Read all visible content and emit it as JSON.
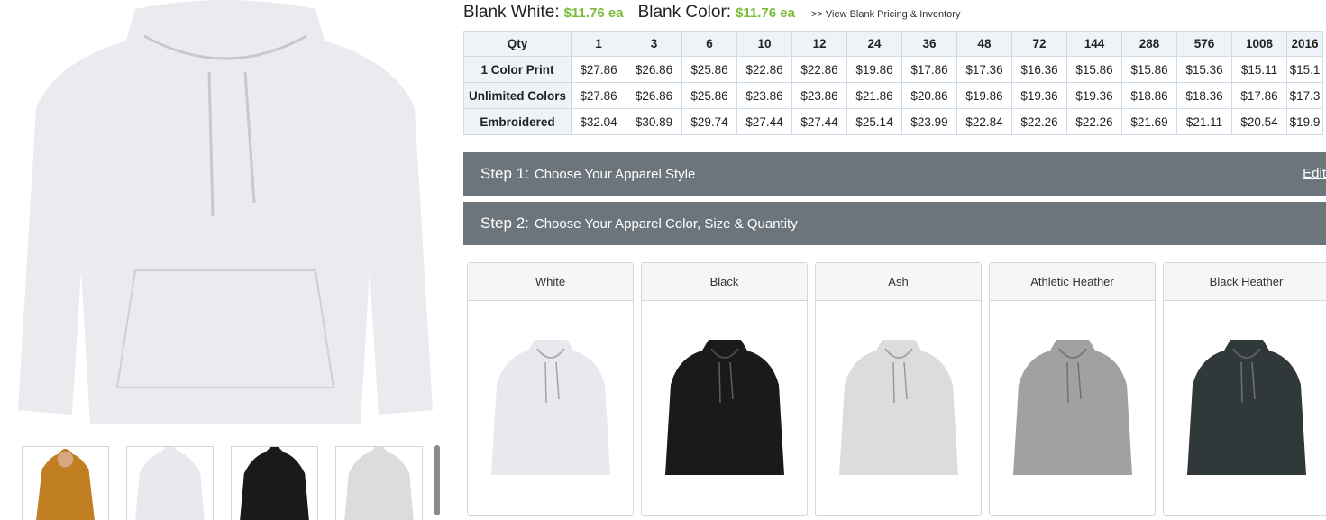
{
  "blank": {
    "white_label": "Blank White:",
    "white_price": "$11.76 ea",
    "color_label": "Blank Color:",
    "color_price": "$11.76 ea",
    "inventory_link": ">> View Blank Pricing & Inventory"
  },
  "pricing": {
    "header_label": "Qty",
    "quantities": [
      "1",
      "3",
      "6",
      "10",
      "12",
      "24",
      "36",
      "48",
      "72",
      "144",
      "288",
      "576",
      "1008",
      "2016"
    ],
    "rows": [
      {
        "label": "1 Color Print",
        "prices": [
          "$27.86",
          "$26.86",
          "$25.86",
          "$22.86",
          "$22.86",
          "$19.86",
          "$17.86",
          "$17.36",
          "$16.36",
          "$15.86",
          "$15.86",
          "$15.36",
          "$15.11",
          "$15.1"
        ]
      },
      {
        "label": "Unlimited Colors",
        "prices": [
          "$27.86",
          "$26.86",
          "$25.86",
          "$23.86",
          "$23.86",
          "$21.86",
          "$20.86",
          "$19.86",
          "$19.36",
          "$19.36",
          "$18.86",
          "$18.36",
          "$17.86",
          "$17.3"
        ]
      },
      {
        "label": "Embroidered",
        "prices": [
          "$32.04",
          "$30.89",
          "$29.74",
          "$27.44",
          "$27.44",
          "$25.14",
          "$23.99",
          "$22.84",
          "$22.26",
          "$22.26",
          "$21.69",
          "$21.11",
          "$20.54",
          "$19.9"
        ]
      }
    ]
  },
  "steps": [
    {
      "number": "Step 1:",
      "text": "Choose Your Apparel Style",
      "action": "Edit"
    },
    {
      "number": "Step 2:",
      "text": "Choose Your Apparel Color, Size & Quantity"
    }
  ],
  "colors": [
    {
      "name": "White",
      "hex": "#e8e9ee"
    },
    {
      "name": "Black",
      "hex": "#1a1a1a"
    },
    {
      "name": "Ash",
      "hex": "#dcdcda"
    },
    {
      "name": "Athletic Heather",
      "hex": "#9fa1a3"
    },
    {
      "name": "Black Heather",
      "hex": "#30383a"
    }
  ],
  "main_image": {
    "hex": "#ebebef"
  },
  "thumbnails": [
    {
      "name": "gold-hoodie",
      "hex": "#c07f22"
    },
    {
      "name": "white-hoodie",
      "hex": "#e8e9ee"
    },
    {
      "name": "black-hoodie",
      "hex": "#1a1a1a"
    },
    {
      "name": "ash-hoodie",
      "hex": "#dcdcda"
    }
  ]
}
